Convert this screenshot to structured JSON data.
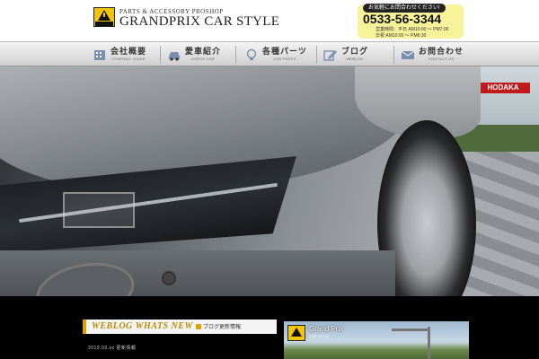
{
  "header": {
    "tagline": "PARTS & ACCESSORY  PROSHOP",
    "brand": "GRANDPRIX CAR STYLE",
    "logo_text": "GRANDPRIX",
    "contact": {
      "pill": "お気軽にお問合わせください!",
      "phone": "0533-56-3344",
      "hours_weekday": "営業時間：平日 AM10:00 ～ PM7:00",
      "hours_holiday": "日祝 AM10:00 ～ PM6:30"
    }
  },
  "nav": {
    "items": [
      {
        "label": "会社概要",
        "sub": "COMPANY GUIDE",
        "icon": "building-icon"
      },
      {
        "label": "愛車紹介",
        "sub": "USERS CAR",
        "icon": "car-icon"
      },
      {
        "label": "各種パーツ",
        "sub": "CAR PARTS",
        "icon": "lightbulb-icon"
      },
      {
        "label": "ブログ",
        "sub": "WEBLOG",
        "icon": "pencil-icon"
      },
      {
        "label": "お問合わせ",
        "sub": "CONTACT US",
        "icon": "mail-icon"
      }
    ]
  },
  "hero": {
    "sign_text": "HODAKA"
  },
  "blog": {
    "title": "WEBLOG WHATS NEW",
    "subtitle": "ブログ更新情報",
    "entry": "2019.03.xx 更新情報"
  },
  "banner": {
    "title": "Grand Prix",
    "subtitle": "CAR STYLE"
  },
  "colors": {
    "accent": "#d9a400",
    "logo_yellow": "#f2c700",
    "contact_bg": "#f8f29a",
    "sign_red": "#c01a1a"
  }
}
